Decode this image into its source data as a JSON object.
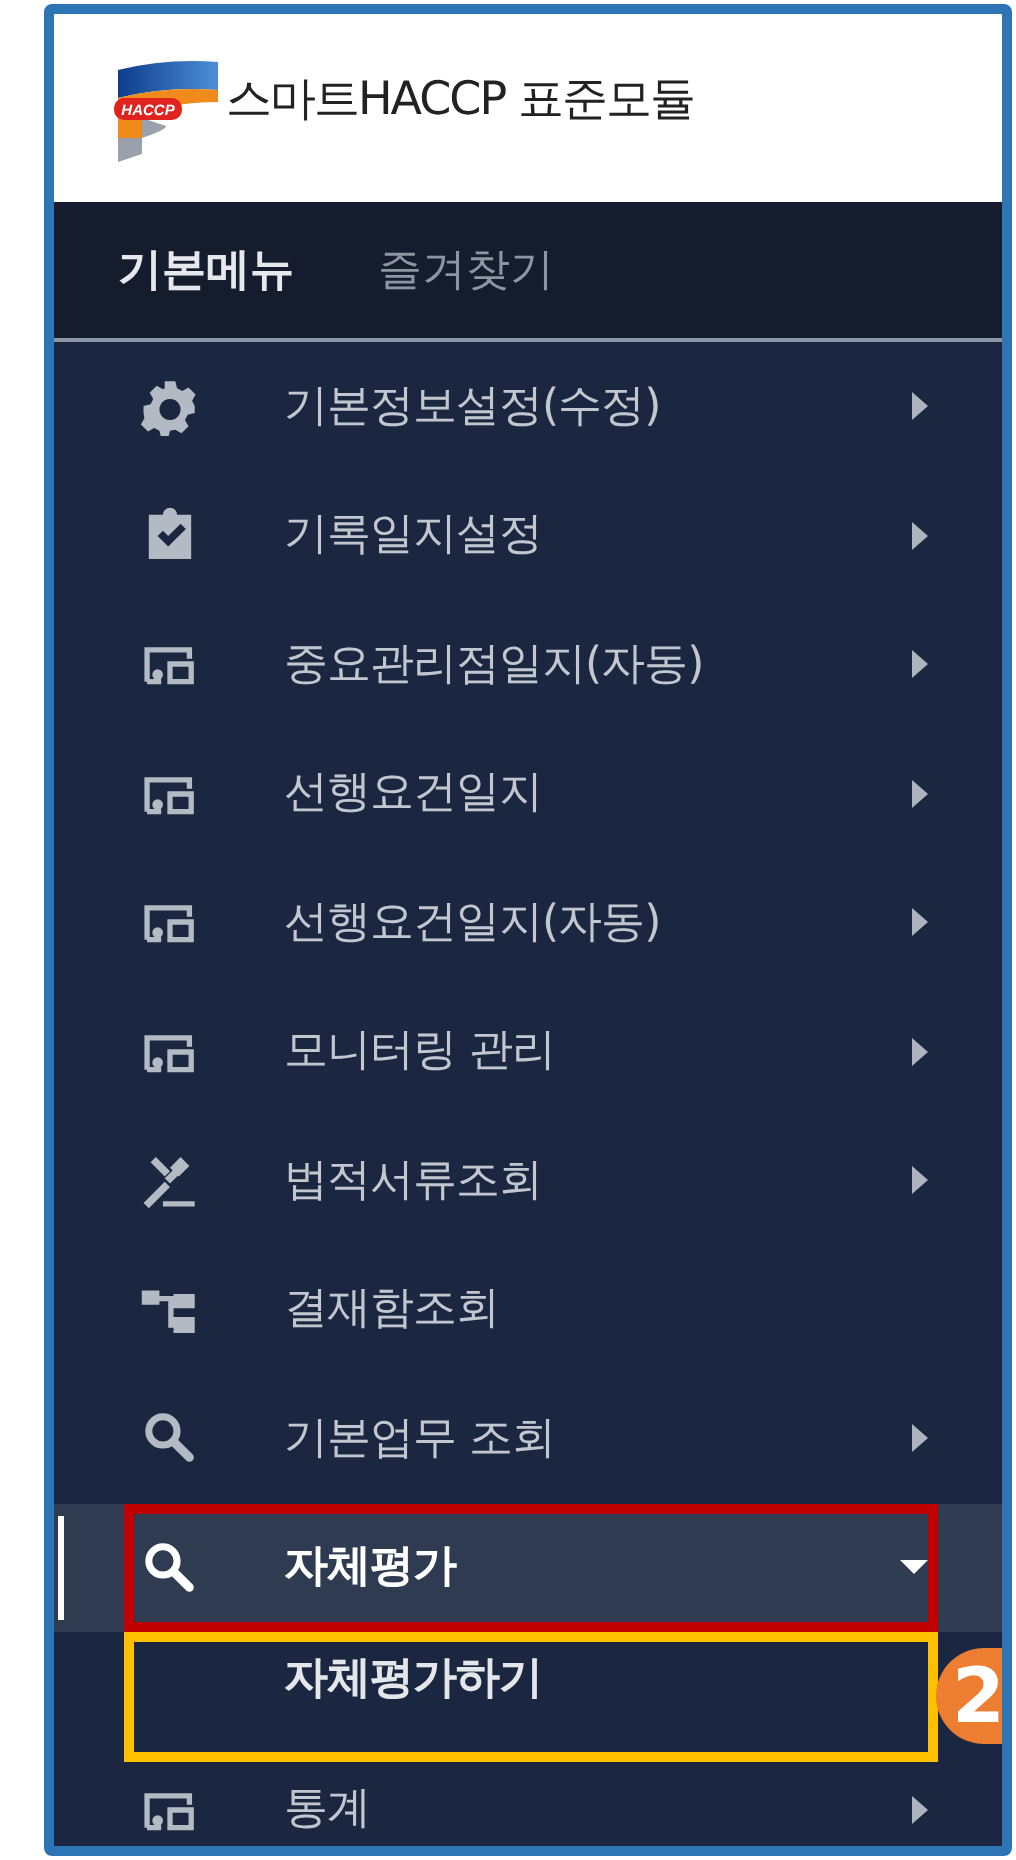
{
  "header": {
    "logo_text": "HACCP",
    "title": "스마트HACCP 표준모듈"
  },
  "tabs": [
    {
      "label": "기본메뉴",
      "selected": true
    },
    {
      "label": "즐겨찾기",
      "selected": false
    }
  ],
  "menu": [
    {
      "label": "기본정보설정(수정)",
      "kind": "gear",
      "expanded": false,
      "selected": false
    },
    {
      "label": "기록일지설정",
      "kind": "clipboard",
      "expanded": false,
      "selected": false
    },
    {
      "label": "중요관리점일지(자동)",
      "kind": "monitor",
      "expanded": false,
      "selected": false
    },
    {
      "label": "선행요건일지",
      "kind": "monitor",
      "expanded": false,
      "selected": false
    },
    {
      "label": "선행요건일지(자동)",
      "kind": "monitor",
      "expanded": false,
      "selected": false
    },
    {
      "label": "모니터링 관리",
      "kind": "monitor",
      "expanded": false,
      "selected": false
    },
    {
      "label": "법적서류조회",
      "kind": "gavel",
      "expanded": false,
      "selected": false
    },
    {
      "label": "결재함조회",
      "kind": "org",
      "selected": false
    },
    {
      "label": "기본업무 조회",
      "kind": "search",
      "expanded": false,
      "selected": false
    },
    {
      "label": "자체평가",
      "kind": "search",
      "expanded": true,
      "selected": true,
      "color": "#c00000",
      "children": [
        {
          "label": "자체평가하기",
          "color": "#ffc000",
          "badge": {
            "label": "2",
            "color": "#ed7d31"
          }
        }
      ]
    },
    {
      "label": "통계",
      "kind": "monitor",
      "expanded": false,
      "selected": false
    }
  ]
}
